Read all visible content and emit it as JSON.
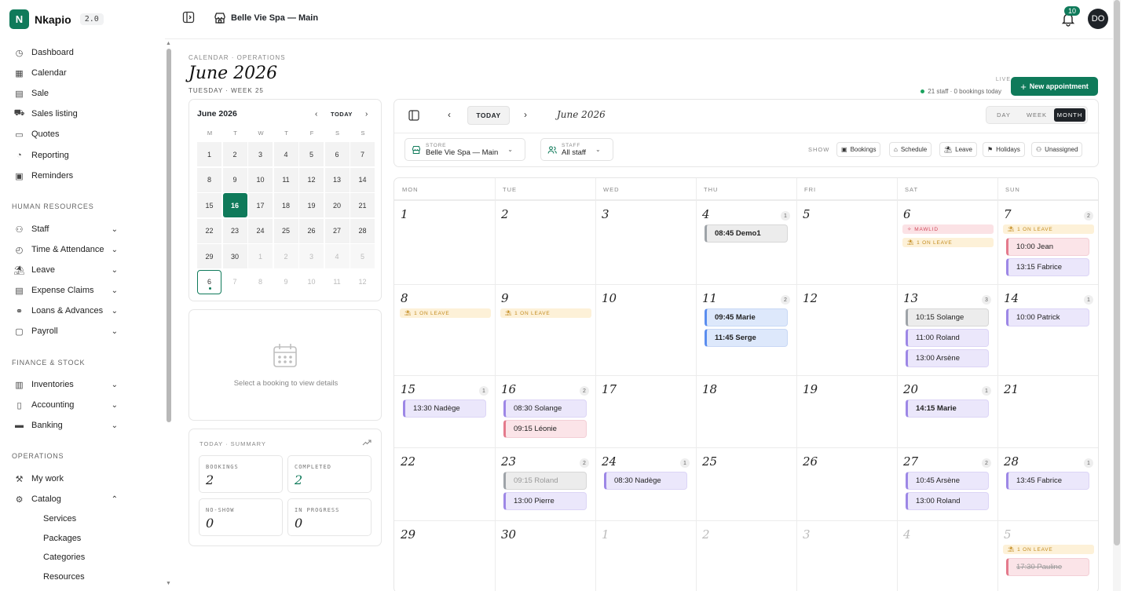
{
  "brand": {
    "name": "Nkapio",
    "version": "2.0",
    "logo_letter": "N",
    "color": "#0f7a5a"
  },
  "header": {
    "store": "Belle Vie Spa — Main",
    "notifications": "10",
    "avatar": "DO"
  },
  "sidebar": {
    "main_items": [
      {
        "label": "Dashboard",
        "icon": "dashboard-icon"
      },
      {
        "label": "Calendar",
        "icon": "calendar-icon"
      },
      {
        "label": "Sale",
        "icon": "sale-icon"
      },
      {
        "label": "Sales listing",
        "icon": "cart-icon"
      },
      {
        "label": "Quotes",
        "icon": "document-icon"
      },
      {
        "label": "Reporting",
        "icon": "pie-chart-icon"
      },
      {
        "label": "Reminders",
        "icon": "reminder-icon"
      }
    ],
    "sections": [
      "HUMAN RESOURCES",
      "FINANCE & STOCK",
      "OPERATIONS"
    ],
    "hr_items": [
      {
        "label": "Staff",
        "icon": "users-icon"
      },
      {
        "label": "Time & Attendance",
        "icon": "clock-icon"
      },
      {
        "label": "Leave",
        "icon": "leave-icon"
      },
      {
        "label": "Expense Claims",
        "icon": "receipt-icon"
      },
      {
        "label": "Loans & Advances",
        "icon": "handshake-icon"
      },
      {
        "label": "Payroll",
        "icon": "payroll-icon"
      }
    ],
    "finance_items": [
      {
        "label": "Inventories",
        "icon": "inventory-icon"
      },
      {
        "label": "Accounting",
        "icon": "book-icon"
      },
      {
        "label": "Banking",
        "icon": "bank-icon"
      }
    ],
    "ops_items": [
      {
        "label": "My work",
        "icon": "wrench-icon"
      },
      {
        "label": "Catalog",
        "icon": "gear-icon"
      }
    ],
    "catalog_sub": [
      "Services",
      "Packages",
      "Categories",
      "Resources"
    ]
  },
  "page": {
    "breadcrumb": "CALENDAR · OPERATIONS",
    "title": "June 2026",
    "subtitle": "TUESDAY · WEEK 25",
    "live_label": "LIVE",
    "live_info": "21 staff · 0 bookings today",
    "new_button": "New appointment"
  },
  "mini": {
    "title": "June 2026",
    "today": "TODAY",
    "dow": [
      "M",
      "T",
      "W",
      "T",
      "F",
      "S",
      "S"
    ],
    "weeks": [
      [
        "1",
        "2",
        "3",
        "4",
        "5",
        "6",
        "7"
      ],
      [
        "8",
        "9",
        "10",
        "11",
        "12",
        "13",
        "14"
      ],
      [
        "15",
        "16",
        "17",
        "18",
        "19",
        "20",
        "21"
      ],
      [
        "22",
        "23",
        "24",
        "25",
        "26",
        "27",
        "28"
      ],
      [
        "29",
        "30",
        "1",
        "2",
        "3",
        "4",
        "5"
      ],
      [
        "6",
        "7",
        "8",
        "9",
        "10",
        "11",
        "12"
      ]
    ]
  },
  "detail": {
    "empty_text": "Select a booking to view details"
  },
  "summary": {
    "title": "TODAY · SUMMARY",
    "stats": [
      {
        "label": "BOOKINGS",
        "value": "2"
      },
      {
        "label": "COMPLETED",
        "value": "2"
      },
      {
        "label": "NO-SHOW",
        "value": "0"
      },
      {
        "label": "IN PROGRESS",
        "value": "0"
      }
    ]
  },
  "toolbar": {
    "today": "TODAY",
    "month": "June 2026",
    "views": [
      "DAY",
      "WEEK",
      "MONTH"
    ],
    "store_label": "STORE",
    "store_value": "Belle Vie Spa — Main",
    "staff_label": "STAFF",
    "staff_value": "All staff",
    "show_label": "SHOW",
    "chips": [
      "Bookings",
      "Schedule",
      "Leave",
      "Holidays",
      "Unassigned"
    ]
  },
  "month": {
    "dow": [
      "MON",
      "TUE",
      "WED",
      "THU",
      "FRI",
      "SAT",
      "SUN"
    ],
    "weeks": [
      [
        {
          "d": "1"
        },
        {
          "d": "2"
        },
        {
          "d": "3"
        },
        {
          "d": "4",
          "count": "1",
          "events": [
            {
              "t": "08:45 Demo1",
              "c": "gray",
              "bold": true
            }
          ]
        },
        {
          "d": "5"
        },
        {
          "d": "6",
          "tags": [
            {
              "k": "holiday",
              "t": "MAWLID"
            },
            {
              "k": "leave",
              "t": "1 ON LEAVE"
            }
          ]
        },
        {
          "d": "7",
          "count": "2",
          "tags": [
            {
              "k": "leave",
              "t": "1 ON LEAVE"
            }
          ],
          "events": [
            {
              "t": "10:00 Jean",
              "c": "pink"
            },
            {
              "t": "13:15 Fabrice",
              "c": "purple"
            }
          ]
        }
      ],
      [
        {
          "d": "8",
          "tags": [
            {
              "k": "leave",
              "t": "1 ON LEAVE"
            }
          ]
        },
        {
          "d": "9",
          "tags": [
            {
              "k": "leave",
              "t": "1 ON LEAVE"
            }
          ]
        },
        {
          "d": "10"
        },
        {
          "d": "11",
          "count": "2",
          "events": [
            {
              "t": "09:45 Marie",
              "c": "blue",
              "bold": true
            },
            {
              "t": "11:45 Serge",
              "c": "blue",
              "bold": true
            }
          ]
        },
        {
          "d": "12"
        },
        {
          "d": "13",
          "count": "3",
          "events": [
            {
              "t": "10:15 Solange",
              "c": "gray"
            },
            {
              "t": "11:00 Roland",
              "c": "purple"
            },
            {
              "t": "13:00 Arsène",
              "c": "purple"
            }
          ]
        },
        {
          "d": "14",
          "count": "1",
          "events": [
            {
              "t": "10:00 Patrick",
              "c": "purple"
            }
          ]
        }
      ],
      [
        {
          "d": "15",
          "count": "1",
          "events": [
            {
              "t": "13:30 Nadège",
              "c": "purple"
            }
          ]
        },
        {
          "d": "16",
          "count": "2",
          "events": [
            {
              "t": "08:30 Solange",
              "c": "purple"
            },
            {
              "t": "09:15 Léonie",
              "c": "pink"
            }
          ]
        },
        {
          "d": "17"
        },
        {
          "d": "18"
        },
        {
          "d": "19"
        },
        {
          "d": "20",
          "count": "1",
          "events": [
            {
              "t": "14:15 Marie",
              "c": "purple",
              "bold": true
            }
          ]
        },
        {
          "d": "21"
        }
      ],
      [
        {
          "d": "22"
        },
        {
          "d": "23",
          "count": "2",
          "events": [
            {
              "t": "09:15 Roland",
              "c": "gray",
              "dim": true
            },
            {
              "t": "13:00 Pierre",
              "c": "purple"
            }
          ]
        },
        {
          "d": "24",
          "count": "1",
          "events": [
            {
              "t": "08:30 Nadège",
              "c": "purple"
            }
          ]
        },
        {
          "d": "25"
        },
        {
          "d": "26"
        },
        {
          "d": "27",
          "count": "2",
          "events": [
            {
              "t": "10:45 Arsène",
              "c": "purple"
            },
            {
              "t": "13:00 Roland",
              "c": "purple"
            }
          ]
        },
        {
          "d": "28",
          "count": "1",
          "events": [
            {
              "t": "13:45 Fabrice",
              "c": "purple"
            }
          ]
        }
      ],
      [
        {
          "d": "29"
        },
        {
          "d": "30"
        },
        {
          "d": "1",
          "faded": true
        },
        {
          "d": "2",
          "faded": true
        },
        {
          "d": "3",
          "faded": true
        },
        {
          "d": "4",
          "faded": true
        },
        {
          "d": "5",
          "faded": true,
          "tags": [
            {
              "k": "leave",
              "t": "1 ON LEAVE"
            }
          ],
          "events": [
            {
              "t": "17:30 Pauline",
              "c": "pink",
              "strike": true
            }
          ]
        }
      ]
    ]
  }
}
